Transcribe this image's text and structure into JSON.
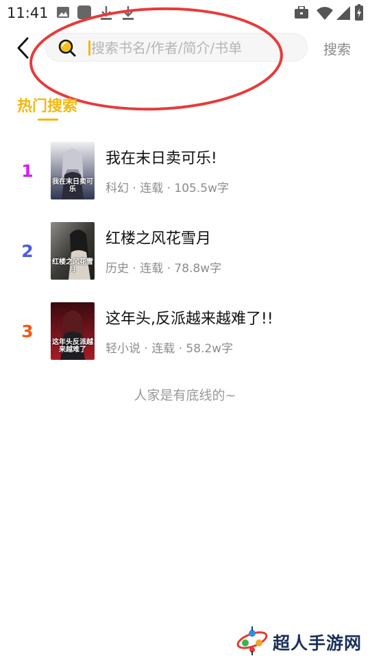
{
  "status_bar": {
    "time": "11:41",
    "left_icons": [
      "image-icon",
      "app-square-icon",
      "download-icon",
      "download-icon"
    ],
    "right_icons": [
      "briefcase-icon",
      "wifi-icon",
      "signal-icon",
      "battery-icon"
    ]
  },
  "header": {
    "back_icon": "chevron-left-icon",
    "search_icon": "search-icon",
    "search_placeholder": "搜索书名/作者/简介/书单",
    "search_value": "",
    "search_button_label": "搜索"
  },
  "hot_search": {
    "title": "热门搜索",
    "accent_color": "#f2b90c",
    "items": [
      {
        "rank": "1",
        "rank_color": "#d21ff0",
        "title": "我在末日卖可乐!",
        "meta": "科幻 · 连载 · 105.5w字",
        "cover_text": "我在末日卖可乐",
        "cover_colors": [
          "#e9e9ee",
          "#3a3f5a"
        ]
      },
      {
        "rank": "2",
        "rank_color": "#4b5be6",
        "title": "红楼之风花雪月",
        "meta": "历史 · 连载 · 78.8w字",
        "cover_text": "红楼之风花雪月",
        "cover_colors": [
          "#2a2a28",
          "#6b5a45"
        ]
      },
      {
        "rank": "3",
        "rank_color": "#f05a14",
        "title": "这年头,反派越来越难了!!",
        "meta": "轻小说 · 连载 · 58.2w字",
        "cover_text": "这年头反派越来越难了",
        "cover_colors": [
          "#3a0a10",
          "#b01e2a"
        ]
      }
    ],
    "footer": "人家是有底线的~"
  },
  "annotation_color": "#e83a3a",
  "watermark": {
    "text": "超人手游网"
  }
}
